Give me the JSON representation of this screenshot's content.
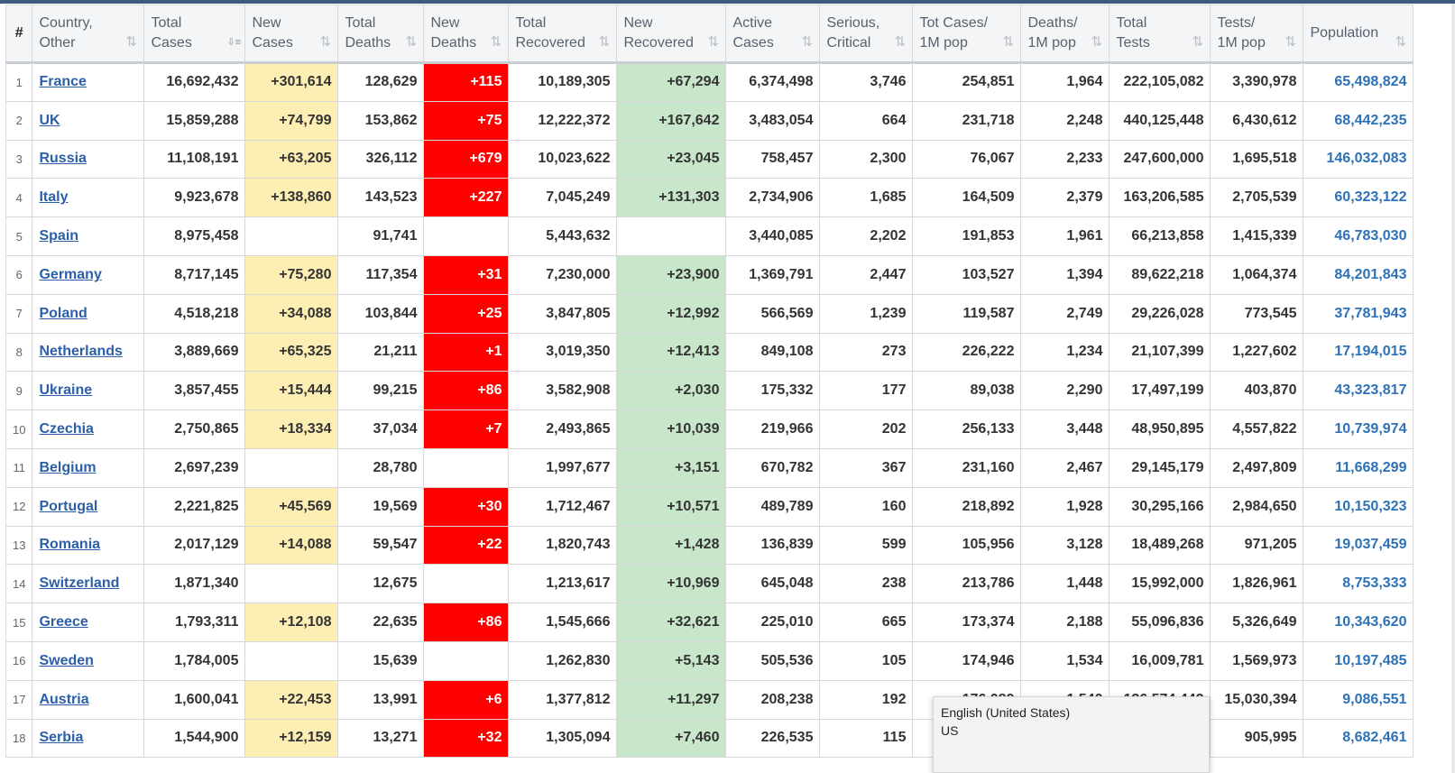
{
  "headers": [
    {
      "key": "num",
      "label": "#"
    },
    {
      "key": "country",
      "label": "Country,\nOther"
    },
    {
      "key": "total_cases",
      "label": "Total\nCases"
    },
    {
      "key": "new_cases",
      "label": "New\nCases"
    },
    {
      "key": "total_deaths",
      "label": "Total\nDeaths"
    },
    {
      "key": "new_deaths",
      "label": "New\nDeaths"
    },
    {
      "key": "total_recovered",
      "label": "Total\nRecovered"
    },
    {
      "key": "new_recovered",
      "label": "New\nRecovered"
    },
    {
      "key": "active",
      "label": "Active\nCases"
    },
    {
      "key": "serious",
      "label": "Serious,\nCritical"
    },
    {
      "key": "cases_1m",
      "label": "Tot Cases/\n1M pop"
    },
    {
      "key": "deaths_1m",
      "label": "Deaths/\n1M pop"
    },
    {
      "key": "total_tests",
      "label": "Total\nTests"
    },
    {
      "key": "tests_1m",
      "label": "Tests/\n1M pop"
    },
    {
      "key": "population",
      "label": "Population"
    }
  ],
  "sort_icon": "sort-arrows-icon",
  "colors": {
    "new_cases_bg": "#fdeeb4",
    "new_deaths_bg": "#ff0000",
    "new_recovered_bg": "#c8e6c9",
    "country_link": "#2b5fa8",
    "population_text": "#2d72b8"
  },
  "rows": [
    [
      "1",
      "France",
      "16,692,432",
      "+301,614",
      "128,629",
      "+115",
      "10,189,305",
      "+67,294",
      "6,374,498",
      "3,746",
      "254,851",
      "1,964",
      "222,105,082",
      "3,390,978",
      "65,498,824"
    ],
    [
      "2",
      "UK",
      "15,859,288",
      "+74,799",
      "153,862",
      "+75",
      "12,222,372",
      "+167,642",
      "3,483,054",
      "664",
      "231,718",
      "2,248",
      "440,125,448",
      "6,430,612",
      "68,442,235"
    ],
    [
      "3",
      "Russia",
      "11,108,191",
      "+63,205",
      "326,112",
      "+679",
      "10,023,622",
      "+23,045",
      "758,457",
      "2,300",
      "76,067",
      "2,233",
      "247,600,000",
      "1,695,518",
      "146,032,083"
    ],
    [
      "4",
      "Italy",
      "9,923,678",
      "+138,860",
      "143,523",
      "+227",
      "7,045,249",
      "+131,303",
      "2,734,906",
      "1,685",
      "164,509",
      "2,379",
      "163,206,585",
      "2,705,539",
      "60,323,122"
    ],
    [
      "5",
      "Spain",
      "8,975,458",
      "",
      "91,741",
      "",
      "5,443,632",
      "",
      "3,440,085",
      "2,202",
      "191,853",
      "1,961",
      "66,213,858",
      "1,415,339",
      "46,783,030"
    ],
    [
      "6",
      "Germany",
      "8,717,145",
      "+75,280",
      "117,354",
      "+31",
      "7,230,000",
      "+23,900",
      "1,369,791",
      "2,447",
      "103,527",
      "1,394",
      "89,622,218",
      "1,064,374",
      "84,201,843"
    ],
    [
      "7",
      "Poland",
      "4,518,218",
      "+34,088",
      "103,844",
      "+25",
      "3,847,805",
      "+12,992",
      "566,569",
      "1,239",
      "119,587",
      "2,749",
      "29,226,028",
      "773,545",
      "37,781,943"
    ],
    [
      "8",
      "Netherlands",
      "3,889,669",
      "+65,325",
      "21,211",
      "+1",
      "3,019,350",
      "+12,413",
      "849,108",
      "273",
      "226,222",
      "1,234",
      "21,107,399",
      "1,227,602",
      "17,194,015"
    ],
    [
      "9",
      "Ukraine",
      "3,857,455",
      "+15,444",
      "99,215",
      "+86",
      "3,582,908",
      "+2,030",
      "175,332",
      "177",
      "89,038",
      "2,290",
      "17,497,199",
      "403,870",
      "43,323,817"
    ],
    [
      "10",
      "Czechia",
      "2,750,865",
      "+18,334",
      "37,034",
      "+7",
      "2,493,865",
      "+10,039",
      "219,966",
      "202",
      "256,133",
      "3,448",
      "48,950,895",
      "4,557,822",
      "10,739,974"
    ],
    [
      "11",
      "Belgium",
      "2,697,239",
      "",
      "28,780",
      "",
      "1,997,677",
      "+3,151",
      "670,782",
      "367",
      "231,160",
      "2,467",
      "29,145,179",
      "2,497,809",
      "11,668,299"
    ],
    [
      "12",
      "Portugal",
      "2,221,825",
      "+45,569",
      "19,569",
      "+30",
      "1,712,467",
      "+10,571",
      "489,789",
      "160",
      "218,892",
      "1,928",
      "30,295,166",
      "2,984,650",
      "10,150,323"
    ],
    [
      "13",
      "Romania",
      "2,017,129",
      "+14,088",
      "59,547",
      "+22",
      "1,820,743",
      "+1,428",
      "136,839",
      "599",
      "105,956",
      "3,128",
      "18,489,268",
      "971,205",
      "19,037,459"
    ],
    [
      "14",
      "Switzerland",
      "1,871,340",
      "",
      "12,675",
      "",
      "1,213,617",
      "+10,969",
      "645,048",
      "238",
      "213,786",
      "1,448",
      "15,992,000",
      "1,826,961",
      "8,753,333"
    ],
    [
      "15",
      "Greece",
      "1,793,311",
      "+12,108",
      "22,635",
      "+86",
      "1,545,666",
      "+32,621",
      "225,010",
      "665",
      "173,374",
      "2,188",
      "55,096,836",
      "5,326,649",
      "10,343,620"
    ],
    [
      "16",
      "Sweden",
      "1,784,005",
      "",
      "15,639",
      "",
      "1,262,830",
      "+5,143",
      "505,536",
      "105",
      "174,946",
      "1,534",
      "16,009,781",
      "1,569,973",
      "10,197,485"
    ],
    [
      "17",
      "Austria",
      "1,600,041",
      "+22,453",
      "13,991",
      "+6",
      "1,377,812",
      "+11,297",
      "208,238",
      "192",
      "176,089",
      "1,540",
      "136,574,442",
      "15,030,394",
      "9,086,551"
    ],
    [
      "18",
      "Serbia",
      "1,544,900",
      "+12,159",
      "13,271",
      "+32",
      "1,305,094",
      "+7,460",
      "226,535",
      "115",
      "",
      "",
      "",
      "905,995",
      "8,682,461"
    ]
  ],
  "tooltip": {
    "line1": "English (United States)",
    "line2": "US"
  }
}
